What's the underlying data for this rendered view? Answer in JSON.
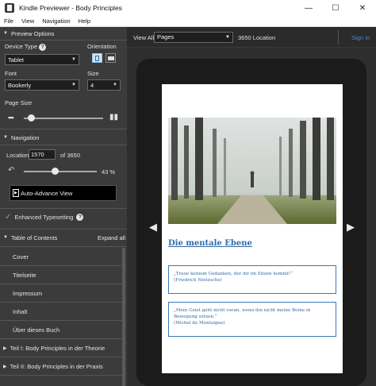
{
  "window": {
    "title": "Kindle Previewer - Body Principles",
    "minimize": "—",
    "maximize": "☐",
    "close": "✕"
  },
  "menu": [
    "File",
    "View",
    "Navigation",
    "Help"
  ],
  "preview_options": {
    "header": "Preview Options",
    "device_type_label": "Device Type",
    "device_type_value": "Tablet",
    "orientation_label": "Orientation",
    "font_label": "Font",
    "font_value": "Bookerly",
    "size_label": "Size",
    "size_value": "4",
    "page_size_label": "Page Size",
    "page_size_fraction": 0.05
  },
  "navigation": {
    "header": "Navigation",
    "location_label": "Location",
    "location_value": "1570",
    "location_total": "of 3650",
    "percent": "43 %",
    "progress_fraction": 0.43,
    "auto_advance": "Auto-Advance View"
  },
  "enhanced_typesetting": "Enhanced Typesetting",
  "toc": {
    "header": "Table of Contents",
    "expand_all": "Expand all",
    "items": [
      "Cover",
      "Titelseite",
      "Impressum",
      "Inhalt",
      "Über dieses Buch",
      "Teil I: Body Principles in der Theorie",
      "Teil II: Body Principles in der Praxis"
    ]
  },
  "viewer": {
    "view_all_label": "View All",
    "view_mode": "Pages",
    "location_text": "3650 Location",
    "sign_in": "Sign In"
  },
  "book": {
    "heading": "Die mentale Ebene",
    "quote1": "„Traue keinem Gedanken, der dir im Sitzen kommt!“",
    "quote1_author": "(Friedrich Nietzsche)",
    "quote2": "„Mein Geist geht nicht voran, wenn ihn nicht meine Beine in Bewegung setzen.“",
    "quote2_author": "(Michel de Montaigne)"
  },
  "colors": {
    "accent_link": "#2f6aa8",
    "check_green": "#5cc04a",
    "sign_in": "#3a8fd8"
  }
}
